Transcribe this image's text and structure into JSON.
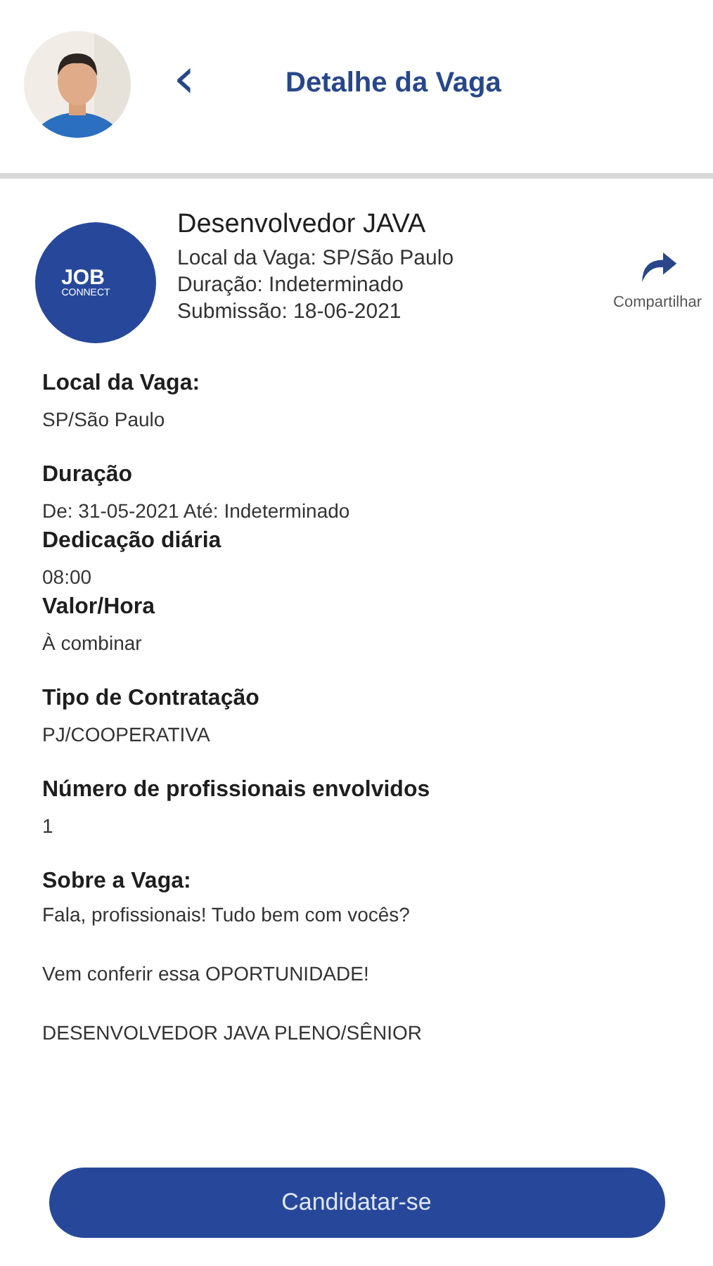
{
  "header": {
    "back_icon": "‹",
    "title": "Detalhe da Vaga"
  },
  "job": {
    "logo": {
      "top": "JOB",
      "bottom": "CONNECT"
    },
    "title": "Desenvolvedor JAVA",
    "lines": [
      "Local da Vaga: SP/São Paulo",
      "Duração: Indeterminado",
      "Submissão: 18-06-2021"
    ],
    "share_label": "Compartilhar"
  },
  "details": [
    {
      "label": "Local da Vaga:",
      "value": "SP/São Paulo"
    },
    {
      "label": "Duração",
      "value": "De: 31-05-2021 Até: Indeterminado"
    },
    {
      "label": "Dedicação diária",
      "value": "08:00"
    },
    {
      "label": "Valor/Hora",
      "value": "À combinar"
    },
    {
      "label": "Tipo de Contratação",
      "value": "PJ/COOPERATIVA"
    },
    {
      "label": "Número de profissionais envolvidos",
      "value": "1"
    }
  ],
  "about": {
    "label": "Sobre a Vaga:",
    "paragraphs": [
      "Fala, profissionais!  Tudo bem com vocês?",
      "Vem conferir essa OPORTUNIDADE!",
      "DESENVOLVEDOR JAVA PLENO/SÊNIOR"
    ]
  },
  "apply_button": "Candidatar-se"
}
